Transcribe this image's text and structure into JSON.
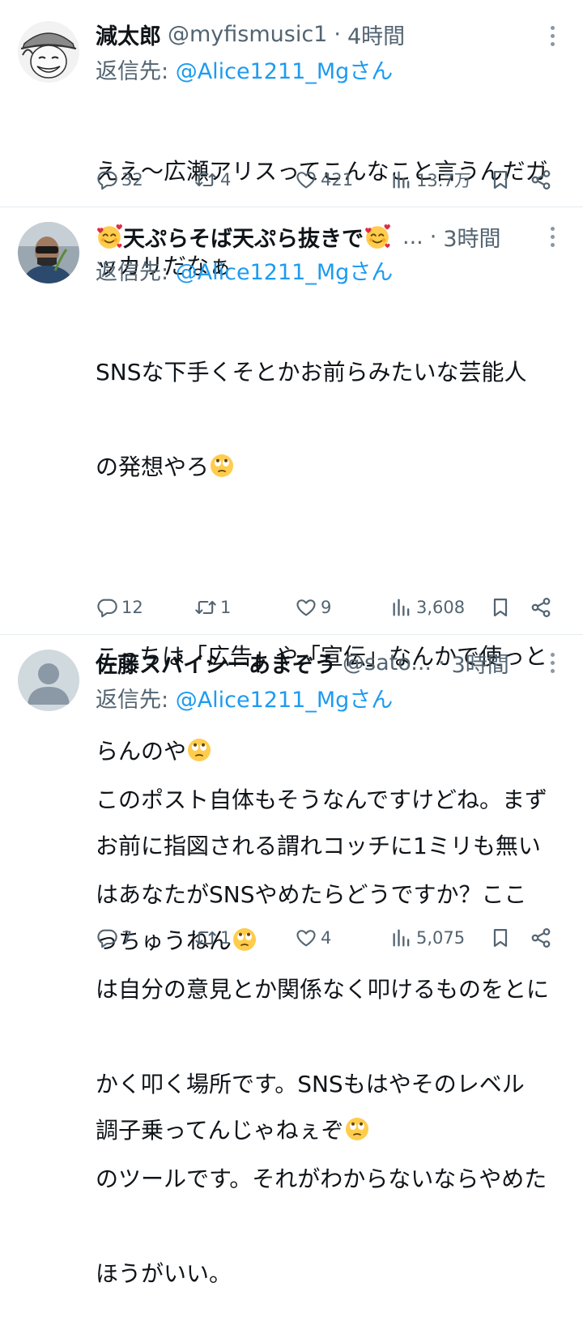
{
  "tweets": [
    {
      "name": "減太郎",
      "handle": "@myfismusic1",
      "separator": "·",
      "time": "4時間",
      "reply_prefix": "返信先: ",
      "reply_mention": "@Alice1211_Mgさん",
      "lines": [
        "ええ～広瀬アリスってこんなこと言うんだガ",
        "ッカリだなぁ"
      ],
      "replies": "32",
      "reposts": "4",
      "likes": "421",
      "views": "13.7万"
    },
    {
      "name_text": "天ぷらそば天ぷら抜きで",
      "name_suffix": "...",
      "separator": "·",
      "time": "3時間",
      "reply_prefix": "返信先: ",
      "reply_mention": "@Alice1211_Mgさん",
      "lines": [
        "SNSな下手くそとかお前らみたいな芸能人",
        "の発想やろ",
        "",
        "こっちは「広告」や「宣伝」なんかで使っと",
        "らんのや",
        "お前に指図される謂れコッチに1ミリも無い",
        "っちゅうねん",
        "",
        "調子乗ってんじゃねぇぞ"
      ],
      "replies": "12",
      "reposts": "1",
      "likes": "9",
      "views": "3,608"
    },
    {
      "name": "佐藤スパイシーあまぞう",
      "handle": "@sato...",
      "separator": "·",
      "time": "3時間",
      "reply_prefix": "返信先: ",
      "reply_mention": "@Alice1211_Mgさん",
      "lines": [
        "このポスト自体もそうなんですけどね。まず",
        "はあなたがSNSやめたらどうですか？ここ",
        "は自分の意見とか関係なく叩けるものをとに",
        "かく叩く場所です。SNSもはやそのレベル",
        "のツールです。それがわからないならやめた",
        "ほうがいい。"
      ],
      "replies": "7",
      "reposts": "1",
      "likes": "4",
      "views": "5,075"
    }
  ],
  "icons": {
    "reply": "reply-icon",
    "repost": "repost-icon",
    "like": "heart-icon",
    "views": "views-chart-icon",
    "bookmark": "bookmark-icon",
    "share": "share-icon",
    "more": "more-icon",
    "emoji_face": "smiling-face-with-hearts-emoji",
    "emoji_eyes": "face-with-rolling-eyes-emoji"
  },
  "colors": {
    "text": "#0f1419",
    "muted": "#536471",
    "link": "#1d9bf0",
    "divider": "#e6ecf0"
  }
}
